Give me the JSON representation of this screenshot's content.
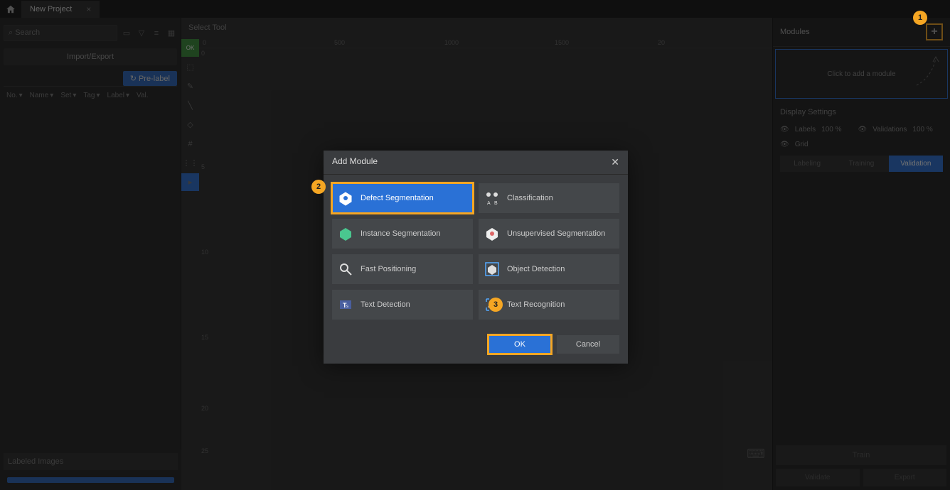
{
  "tab": {
    "title": "New Project"
  },
  "search": {
    "placeholder": "Search"
  },
  "buttons": {
    "import_export": "Import/Export",
    "pre_label": "Pre-label"
  },
  "columns": [
    "No.",
    "Name",
    "Set",
    "Tag",
    "Label",
    "Val."
  ],
  "canvas": {
    "select_tool": "Select Tool",
    "rulerH": [
      "0",
      "500",
      "1000",
      "1500",
      "20"
    ],
    "rulerV": [
      "0",
      "5",
      "10",
      "15",
      "20",
      "25"
    ]
  },
  "right": {
    "modules_title": "Modules",
    "placeholder": "Click to add a module",
    "display_settings": "Display Settings",
    "labels": "Labels",
    "labels_pct": "100 %",
    "validations": "Validations",
    "validations_pct": "100 %",
    "grid": "Grid",
    "tabs": [
      "Labeling",
      "Training",
      "Validation"
    ],
    "train": "Train",
    "validate": "Validate",
    "export": "Export"
  },
  "labeled": {
    "title": "Labeled Images"
  },
  "modal": {
    "title": "Add Module",
    "options": [
      {
        "label": "Defect Segmentation",
        "selected": true
      },
      {
        "label": "Classification"
      },
      {
        "label": "Instance Segmentation"
      },
      {
        "label": "Unsupervised Segmentation"
      },
      {
        "label": "Fast Positioning"
      },
      {
        "label": "Object Detection"
      },
      {
        "label": "Text Detection"
      },
      {
        "label": "Text Recognition"
      }
    ],
    "ok": "OK",
    "cancel": "Cancel"
  },
  "annotations": {
    "b1": "1",
    "b2": "2",
    "b3": "3"
  }
}
